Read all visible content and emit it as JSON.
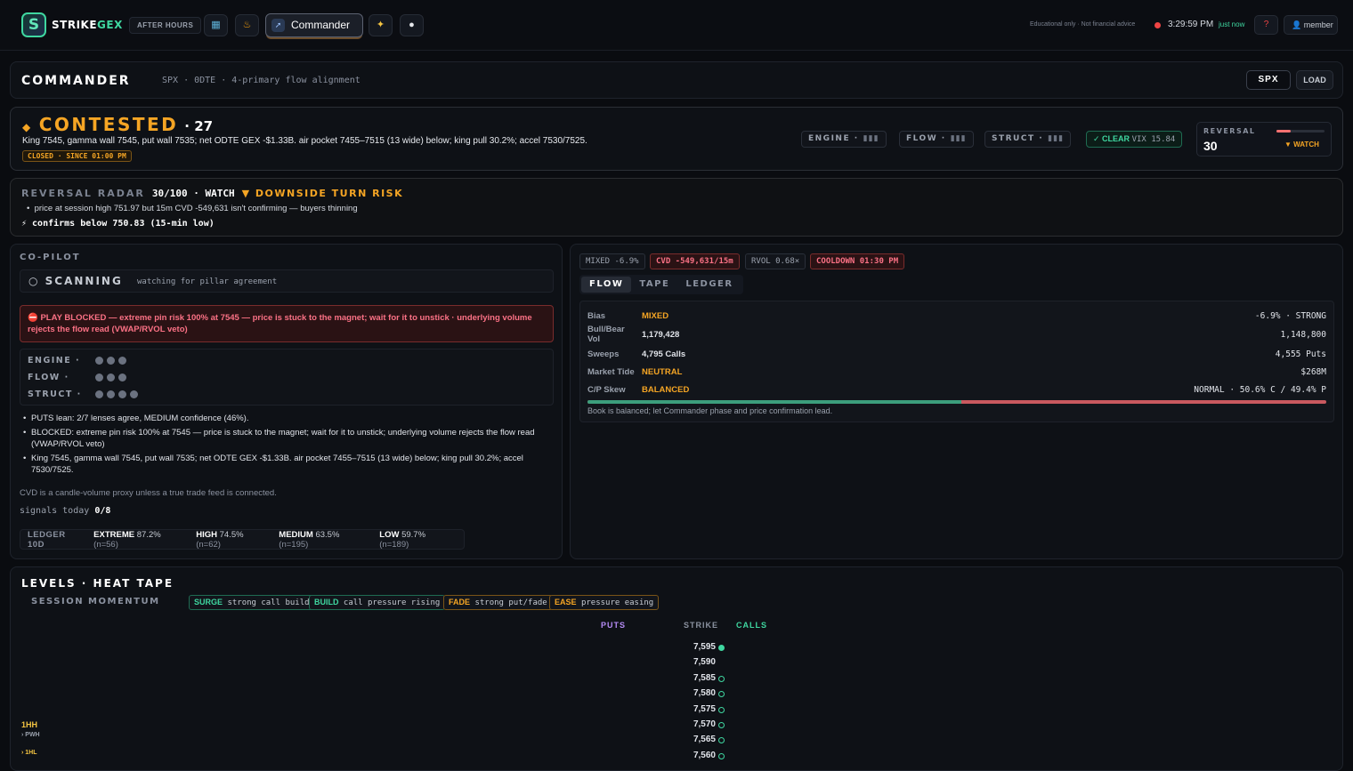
{
  "topbar": {
    "logo_s": "S",
    "logo_strike": "STRIKE",
    "logo_gex": "GEX",
    "after_hours": "AFTER HOURS",
    "nav_icons": [
      "dashboard-icon",
      "fire-icon",
      "sparkle-icon",
      "chat-icon"
    ],
    "active_tab": "Commander",
    "disclaimer": "Educational only · Not financial advice",
    "time": "3:29:59 PM",
    "updated": "just now",
    "help": "?",
    "member": "member"
  },
  "commander": {
    "title": "COMMANDER",
    "subtitle": "SPX · 0DTE · 4-primary flow alignment",
    "symbol_btn": "SPX",
    "load_btn": "LOAD"
  },
  "phase": {
    "name": "CONTESTED",
    "score": "27",
    "description": "King 7545, gamma wall 7545, put wall 7535; net ODTE GEX -$1.33B. air pocket 7455–7515 (13 wide) below; king pull 30.2%; accel 7530/7525.",
    "status_tag": "CLOSED · SINCE 01:00 PM",
    "pillars": [
      {
        "name": "ENGINE",
        "sep": "·",
        "bars": "▮▮▮"
      },
      {
        "name": "FLOW",
        "sep": "·",
        "bars": "▮▮▮"
      },
      {
        "name": "STRUCT",
        "sep": "·",
        "bars": "▮▮▮"
      }
    ],
    "clear_label": "✓ CLEAR",
    "vix": "VIX 15.84",
    "reversal": {
      "label": "REVERSAL",
      "value": "30",
      "level": 0.3,
      "status": "▼ WATCH"
    }
  },
  "radar": {
    "title": "REVERSAL RADAR",
    "score": "30/100 · WATCH",
    "risk": "▼ DOWNSIDE TURN RISK",
    "bullet": "price at session high 751.97 but 15m CVD -549,631 isn't confirming — buyers thinning",
    "confirm": "⚡ confirms below 750.83 (15-min low)"
  },
  "copilot": {
    "title": "CO-PILOT",
    "scan_title": "○ SCANNING",
    "scan_sub": "watching for pillar agreement",
    "blocked": "⛔ PLAY BLOCKED — extreme pin risk 100% at 7545 — price is stuck to the magnet; wait for it to unstick · underlying volume rejects the flow read (VWAP/RVOL veto)",
    "pillars": [
      {
        "name": "ENGINE",
        "sep": "·",
        "dots": 3
      },
      {
        "name": "FLOW",
        "sep": "·",
        "dots": 3
      },
      {
        "name": "STRUCT",
        "sep": "·",
        "dots": 4
      }
    ],
    "bullets": [
      "PUTS lean: 2/7 lenses agree, MEDIUM confidence (46%).",
      "BLOCKED: extreme pin risk 100% at 7545 — price is stuck to the magnet; wait for it to unstick; underlying volume rejects the flow read (VWAP/RVOL veto)",
      "King 7545, gamma wall 7545, put wall 7535; net ODTE GEX -$1.33B. air pocket 7455–7515 (13 wide) below; king pull 30.2%; accel 7530/7525."
    ],
    "cvd_note": "CVD is a candle-volume proxy unless a true trade feed is connected.",
    "signals_label": "signals today",
    "signals_value": "0/8",
    "ledger": {
      "label": "LEDGER 10D",
      "items": [
        {
          "k": "EXTREME",
          "v": "87.2%",
          "n": "(n=56)"
        },
        {
          "k": "HIGH",
          "v": "74.5%",
          "n": "(n=62)"
        },
        {
          "k": "MEDIUM",
          "v": "63.5%",
          "n": "(n=195)"
        },
        {
          "k": "LOW",
          "v": "59.7%",
          "n": "(n=189)"
        }
      ]
    }
  },
  "flow": {
    "chips": [
      "MIXED -6.9%",
      "CVD -549,631/15m",
      "RVOL 0.68×",
      "COOLDOWN 01:30 PM"
    ],
    "tabs": [
      "FLOW",
      "TAPE",
      "LEDGER"
    ],
    "rows": [
      {
        "k": "Bias",
        "m": "MIXED",
        "r": "-6.9% · STRONG"
      },
      {
        "k": "Bull/Bear Vol",
        "m": "1,179,428",
        "r": "1,148,800"
      },
      {
        "k": "Sweeps",
        "m": "4,795 Calls",
        "r": "4,555 Puts"
      },
      {
        "k": "Market Tide",
        "m": "NEUTRAL",
        "r": "$268M"
      },
      {
        "k": "C/P Skew",
        "m": "BALANCED",
        "r": "NORMAL · 50.6% C / 49.4% P"
      }
    ],
    "call_share": 0.506,
    "note": "Book is balanced; let Commander phase and price confirmation lead."
  },
  "levels": {
    "title": "LEVELS · HEAT TAPE",
    "momentum_label": "SESSION MOMENTUM",
    "momentum": [
      {
        "tag": "SURGE",
        "text": "strong call build"
      },
      {
        "tag": "BUILD",
        "text": "call pressure rising"
      },
      {
        "tag": "FADE",
        "text": "strong put/fade"
      },
      {
        "tag": "EASE",
        "text": "pressure easing"
      }
    ],
    "headers": {
      "puts": "PUTS",
      "strike": "STRIKE",
      "calls": "CALLS"
    },
    "strikes": [
      {
        "v": "7,595",
        "mark": "filled"
      },
      {
        "v": "7,590",
        "mark": "none"
      },
      {
        "v": "7,585",
        "mark": "ring"
      },
      {
        "v": "7,580",
        "mark": "ring"
      },
      {
        "v": "7,575",
        "mark": "ring"
      },
      {
        "v": "7,570",
        "mark": "ring"
      },
      {
        "v": "7,565",
        "mark": "ring"
      },
      {
        "v": "7,560",
        "mark": "ring"
      }
    ],
    "side_labels": [
      "1HH",
      "PWH",
      "1HL"
    ]
  }
}
